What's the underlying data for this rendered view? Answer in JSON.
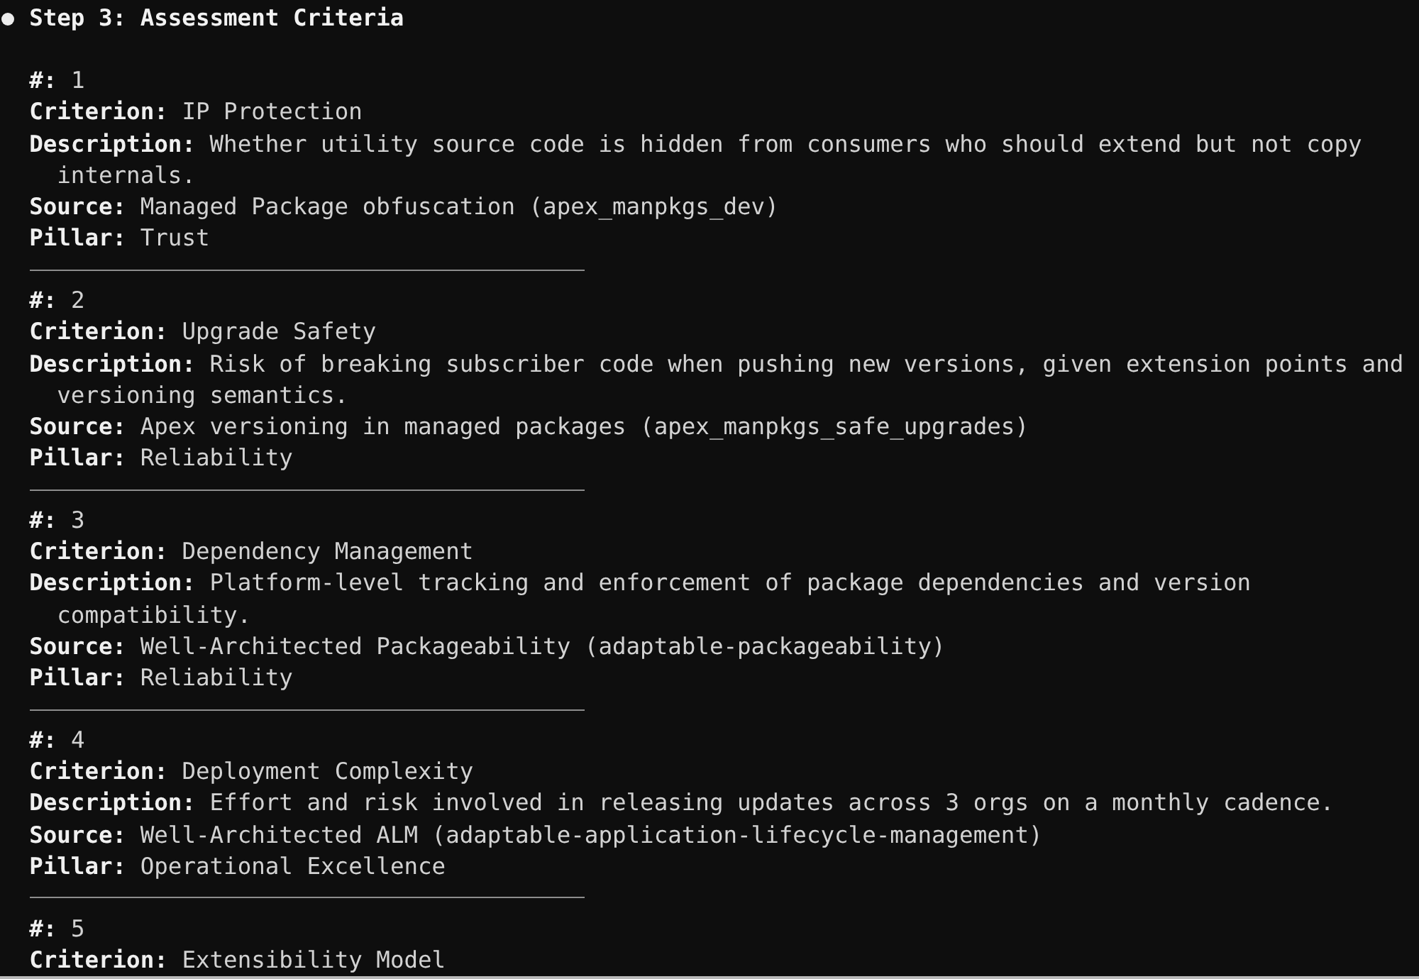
{
  "heading": {
    "title": "Step 3: Assessment Criteria"
  },
  "criteria": [
    {
      "fields": [
        {
          "label": "#:",
          "value": "1"
        },
        {
          "label": "Criterion:",
          "value": "IP Protection"
        },
        {
          "label": "Description:",
          "value": "Whether utility source code is hidden from consumers who should extend but not copy internals."
        },
        {
          "label": "Source:",
          "value": "Managed Package obfuscation (apex_manpkgs_dev)"
        },
        {
          "label": "Pillar:",
          "value": "Trust"
        }
      ]
    },
    {
      "fields": [
        {
          "label": "#:",
          "value": "2"
        },
        {
          "label": "Criterion:",
          "value": "Upgrade Safety"
        },
        {
          "label": "Description:",
          "value": "Risk of breaking subscriber code when pushing new versions, given extension points and versioning semantics."
        },
        {
          "label": "Source:",
          "value": "Apex versioning in managed packages (apex_manpkgs_safe_upgrades)"
        },
        {
          "label": "Pillar:",
          "value": "Reliability"
        }
      ]
    },
    {
      "fields": [
        {
          "label": "#:",
          "value": "3"
        },
        {
          "label": "Criterion:",
          "value": "Dependency Management"
        },
        {
          "label": "Description:",
          "value": "Platform-level tracking and enforcement of package dependencies and version compatibility."
        },
        {
          "label": "Source:",
          "value": "Well-Architected Packageability (adaptable-packageability)"
        },
        {
          "label": "Pillar:",
          "value": "Reliability"
        }
      ]
    },
    {
      "fields": [
        {
          "label": "#:",
          "value": "4"
        },
        {
          "label": "Criterion:",
          "value": "Deployment Complexity"
        },
        {
          "label": "Description:",
          "value": "Effort and risk involved in releasing updates across 3 orgs on a monthly cadence."
        },
        {
          "label": "Source:",
          "value": "Well-Architected ALM (adaptable-application-lifecycle-management)"
        },
        {
          "label": "Pillar:",
          "value": "Operational Excellence"
        }
      ]
    },
    {
      "fields": [
        {
          "label": "#:",
          "value": "5"
        },
        {
          "label": "Criterion:",
          "value": "Extensibility Model"
        }
      ]
    }
  ]
}
